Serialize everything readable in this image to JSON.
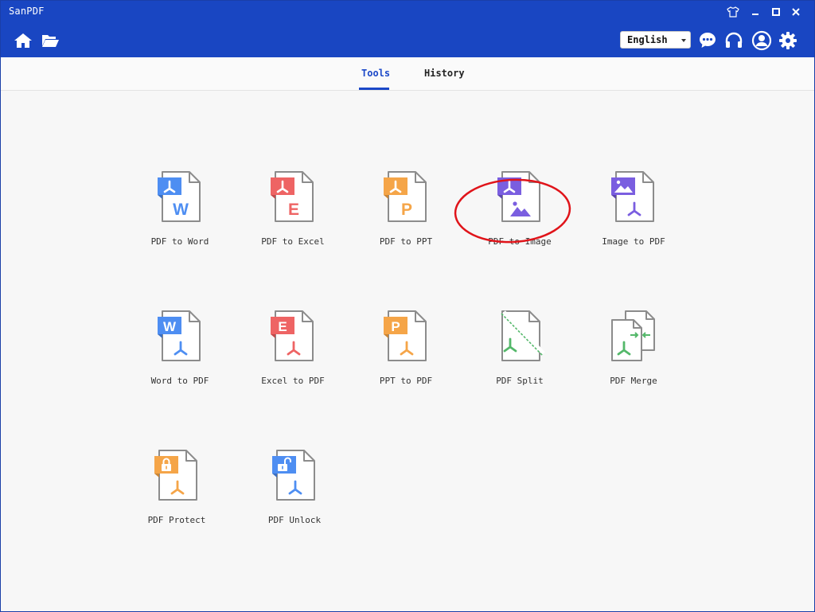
{
  "window": {
    "title": "SanPDF"
  },
  "toolbar": {
    "language": "English"
  },
  "tabs": [
    {
      "label": "Tools"
    },
    {
      "label": "History"
    }
  ],
  "tools": [
    {
      "label": "PDF to Word",
      "badge_letter": "W",
      "color": "#4e8ef2"
    },
    {
      "label": "PDF to Excel",
      "badge_letter": "E",
      "color": "#ee6464"
    },
    {
      "label": "PDF to PPT",
      "badge_letter": "P",
      "color": "#f5a548"
    },
    {
      "label": "PDF to Image",
      "color": "#7a5ee0"
    },
    {
      "label": "Image to PDF",
      "color": "#7a5ee0"
    },
    {
      "label": "Word to PDF",
      "badge_letter": "W",
      "color": "#4e8ef2"
    },
    {
      "label": "Excel to PDF",
      "badge_letter": "E",
      "color": "#ee6464"
    },
    {
      "label": "PPT to PDF",
      "badge_letter": "P",
      "color": "#f5a548"
    },
    {
      "label": "PDF Split",
      "color": "#54b86a"
    },
    {
      "label": "PDF Merge",
      "color": "#54b86a"
    },
    {
      "label": "PDF Protect",
      "color": "#f5a548"
    },
    {
      "label": "PDF Unlock",
      "color": "#4e8ef2"
    }
  ],
  "colors": {
    "brand": "#1946c2",
    "active_tab": "#1b48c8",
    "annotation": "#e0141a"
  }
}
